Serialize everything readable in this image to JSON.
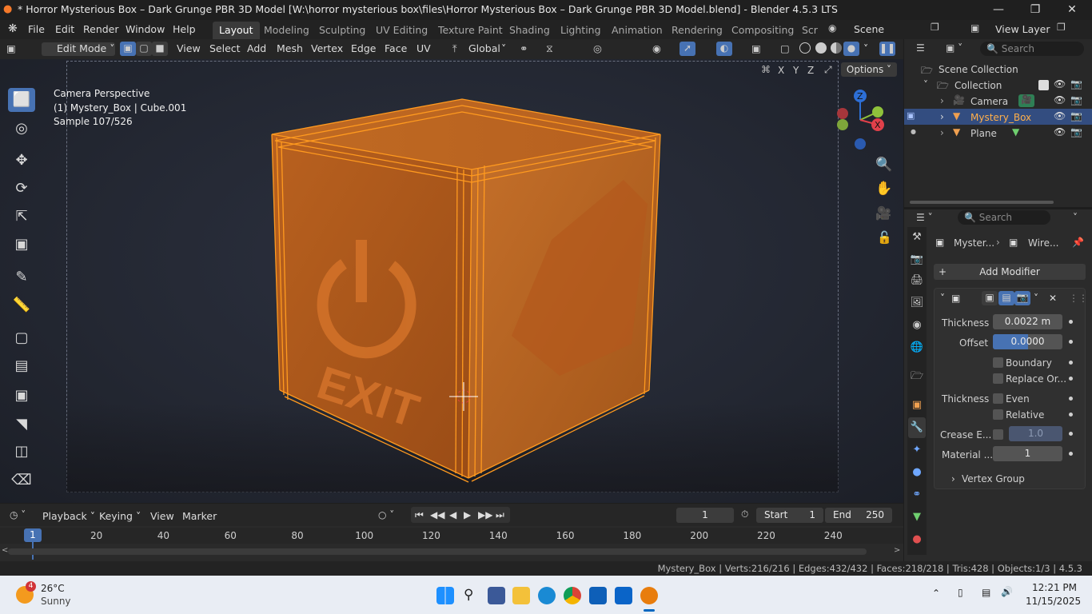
{
  "window": {
    "title": "* Horror Mysterious Box – Dark Grunge PBR 3D Model [W:\\horror mysterious box\\files\\Horror Mysterious Box – Dark Grunge PBR 3D Model.blend] - Blender 4.5.3 LTS",
    "min": "—",
    "max": "❐",
    "close": "✕"
  },
  "menu": [
    "File",
    "Edit",
    "Render",
    "Window",
    "Help"
  ],
  "workspaces": [
    "Layout",
    "Modeling",
    "Sculpting",
    "UV Editing",
    "Texture Paint",
    "Shading",
    "Lighting",
    "Animation",
    "Rendering",
    "Compositing",
    "Scr"
  ],
  "scene": {
    "name": "Scene",
    "view_layer": "View Layer"
  },
  "vp_header": {
    "mode": "Edit Mode",
    "menus": [
      "View",
      "Select",
      "Add",
      "Mesh",
      "Vertex",
      "Edge",
      "Face",
      "UV"
    ],
    "orientation": "Global",
    "axes": [
      "X",
      "Y",
      "Z"
    ],
    "options": "Options"
  },
  "overlay": {
    "line1": "Camera Perspective",
    "line2": "(1) Mystery_Box | Cube.001",
    "line3": "Sample 107/526"
  },
  "cube_text": {
    "exit": "EXIT"
  },
  "outliner": {
    "search": "Search",
    "scene_collection": "Scene Collection",
    "collection": "Collection",
    "items": [
      "Camera",
      "Mystery_Box",
      "Plane"
    ]
  },
  "props": {
    "search": "Search",
    "breadcrumb_obj": "Myster...",
    "breadcrumb_mod": "Wire...",
    "add_modifier": "Add Modifier",
    "thickness_label": "Thickness",
    "thickness_val": "0.0022 m",
    "offset_label": "Offset",
    "offset_val": "0.0000",
    "offset_fill": 0.5,
    "boundary": "Boundary",
    "replace": "Replace Or...",
    "thickness2": "Thickness",
    "even": "Even",
    "relative": "Relative",
    "crease_label": "Crease E...",
    "crease_val": "1.0",
    "material_label": "Material ...",
    "material_val": "1",
    "vertex_group": "Vertex Group"
  },
  "timeline": {
    "menus": [
      "Playback",
      "Keying",
      "View",
      "Marker"
    ],
    "frame": "1",
    "start_label": "Start",
    "start": "1",
    "end_label": "End",
    "end": "250",
    "current": "1",
    "ticks": [
      "20",
      "40",
      "60",
      "80",
      "100",
      "120",
      "140",
      "160",
      "180",
      "200",
      "220",
      "240"
    ]
  },
  "status": "Mystery_Box | Verts:216/216 | Edges:432/432 | Faces:218/218 | Tris:428 | Objects:1/3 | 4.5.3",
  "taskbar": {
    "temp": "26°C",
    "weather": "Sunny",
    "badge": "4",
    "time": "12:21 PM",
    "date": "11/15/2025"
  },
  "colors": {
    "accent": "#4772b3",
    "orange": "#ff9a1f",
    "select": "#e68a2e"
  }
}
